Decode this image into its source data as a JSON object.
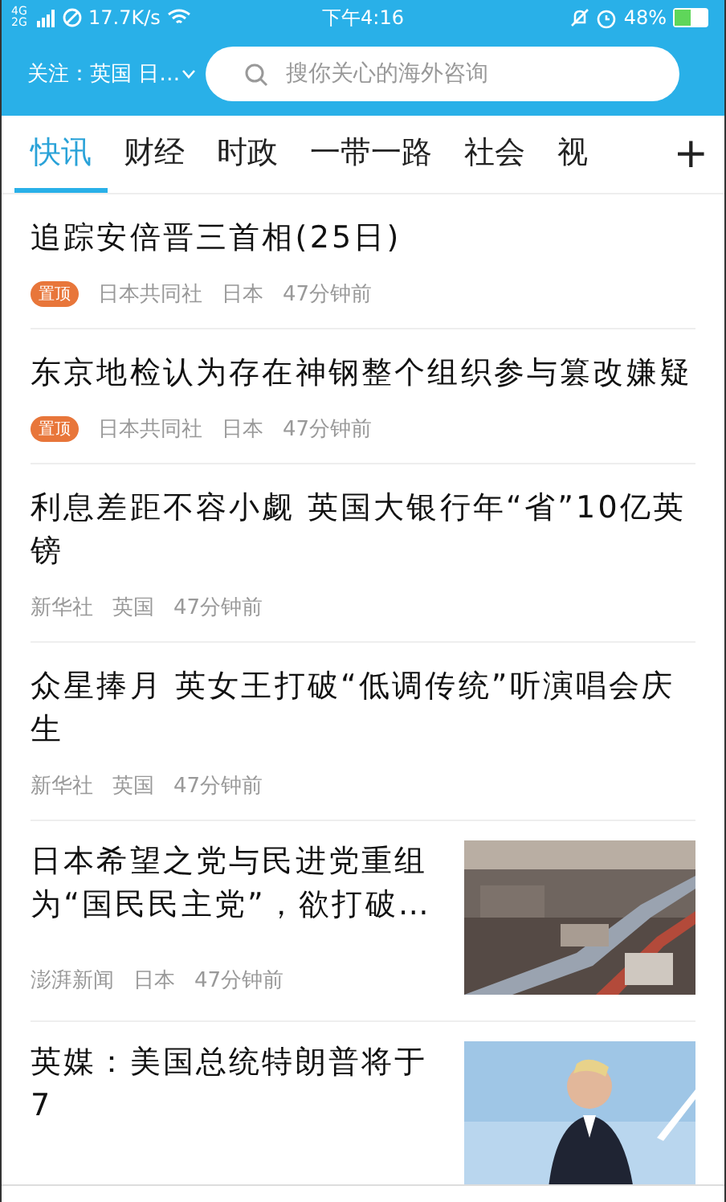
{
  "status_bar": {
    "network": "4G 2G",
    "speed": "17.7K/s",
    "time": "下午4:16",
    "battery": "48%"
  },
  "header": {
    "follow": "关注：英国 日…",
    "search": {
      "placeholder": "搜你关心的海外咨询"
    }
  },
  "tabs": [
    {
      "label": "快讯",
      "selected": true
    },
    {
      "label": "财经",
      "selected": false
    },
    {
      "label": "时政",
      "selected": false
    },
    {
      "label": "一带一路",
      "selected": false
    },
    {
      "label": "社会",
      "selected": false
    },
    {
      "label": "视",
      "selected": false
    }
  ],
  "add_tab": "+",
  "articles": [
    {
      "title": "追踪安倍晋三首相(25日)",
      "badge": "置顶",
      "meta": [
        "日本共同社",
        "日本",
        "47分钟前"
      ]
    },
    {
      "title": "东京地检认为存在神钢整个组织参与篡改嫌疑",
      "badge": "置顶",
      "meta": [
        "日本共同社",
        "日本",
        "47分钟前"
      ]
    },
    {
      "title": "利息差距不容小觑 英国大银行年“省”10亿英镑",
      "meta": [
        "新华社",
        "英国",
        "47分钟前"
      ]
    },
    {
      "title": "众星捧月 英女王打破“低调传统”听演唱会庆生",
      "meta": [
        "新华社",
        "英国",
        "47分钟前"
      ]
    },
    {
      "title": "日本希望之党与民进党重组为“国民民主党”，欲打破…",
      "meta": [
        "澎湃新闻",
        "日本",
        "47分钟前"
      ]
    },
    {
      "title": "英媒：美国总统特朗普将于7"
    }
  ]
}
